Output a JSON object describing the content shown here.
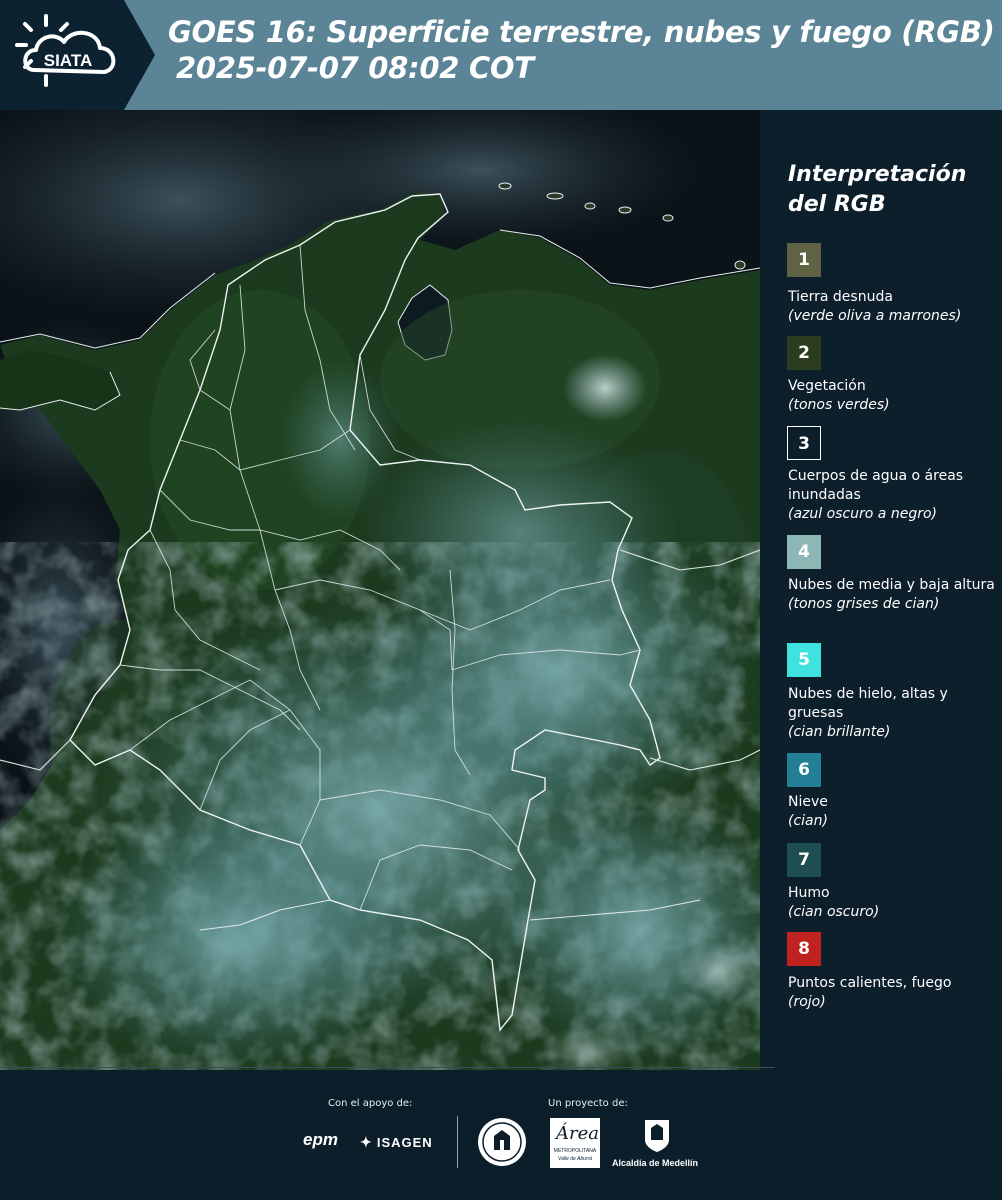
{
  "header": {
    "logo_text": "SIATA",
    "title_line1": "GOES 16: Superficie terrestre, nubes y fuego (RGB)",
    "title_line2": "2025-07-07 08:02 COT"
  },
  "legend": {
    "title": "Interpretación del RGB",
    "items": [
      {
        "number": "1",
        "color": "#5f6243",
        "label": "Tierra desnuda",
        "sub": "(verde oliva a marrones)"
      },
      {
        "number": "2",
        "color": "#2c3c1f",
        "label": "Vegetación",
        "sub": "(tonos verdes)"
      },
      {
        "number": "3",
        "color": "#0c1f2b",
        "label": "Cuerpos de agua o áreas inundadas",
        "sub": "(azul oscuro a negro)"
      },
      {
        "number": "4",
        "color": "#8db7b4",
        "label": "Nubes de media y baja altura",
        "sub": "(tonos grises de cian)"
      },
      {
        "number": "5",
        "color": "#3ee3e0",
        "label": "Nubes de hielo, altas y gruesas",
        "sub": "(cian brillante)"
      },
      {
        "number": "6",
        "color": "#237f95",
        "label": "Nieve",
        "sub": "(cian)"
      },
      {
        "number": "7",
        "color": "#1e4d52",
        "label": "Humo",
        "sub": "(cian oscuro)"
      },
      {
        "number": "8",
        "color": "#c0221f",
        "label": "Puntos calientes, fuego",
        "sub": "(rojo)"
      }
    ]
  },
  "footer": {
    "support_caption": "Con el apoyo de:",
    "project_caption": "Un proyecto de:",
    "sponsors": [
      "epm",
      "ISAGEN"
    ],
    "partners": [
      "METROPOLITANA",
      "Valle de Aburrá",
      "Alcaldía de Medellín"
    ]
  },
  "map": {
    "region": "Colombia",
    "basemap_colors": {
      "vegetation": "#1c3a1e",
      "ocean": "#0b1318",
      "cloud": "#6f9ea3",
      "border": "#e8eef0"
    }
  }
}
